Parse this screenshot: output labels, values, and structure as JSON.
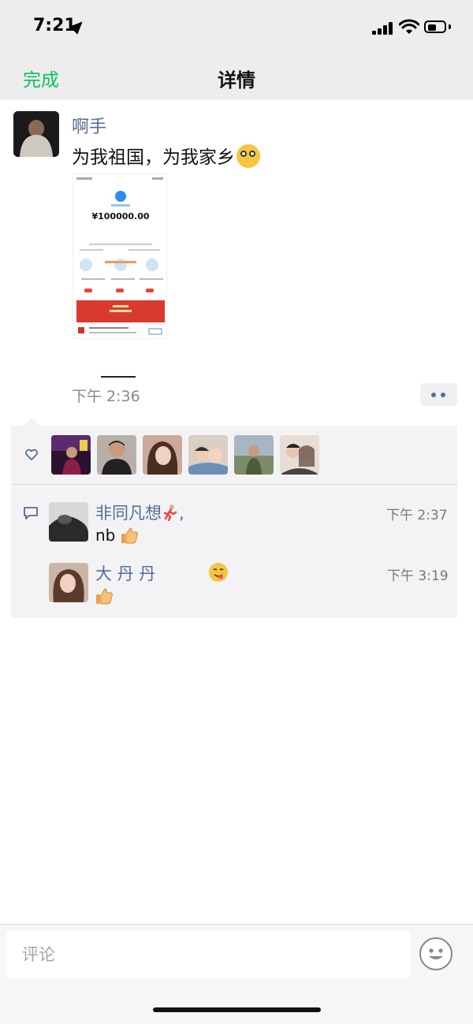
{
  "status_bar": {
    "time": "7:21"
  },
  "nav": {
    "done_label": "完成",
    "title": "详情"
  },
  "post": {
    "author": "啊手",
    "text": "为我祖国，为我家乡",
    "time": "下午 2:36",
    "screenshot": {
      "amount": "¥100000.00"
    }
  },
  "likes": {
    "avatar_colors": [
      "#5a2a6e",
      "#b8b0a8",
      "#caa99a",
      "#d9cfc5",
      "#7d8b6a",
      "#e6ddd5"
    ]
  },
  "comments": [
    {
      "name": "非同凡想",
      "name_suffix": ",",
      "text": "nb",
      "time": "下午 2:37"
    },
    {
      "name": "大 丹 丹",
      "text": "",
      "time": "下午 3:19"
    }
  ],
  "input": {
    "placeholder": "评论"
  },
  "colors": {
    "accent": "#07c160",
    "link": "#576b95"
  }
}
